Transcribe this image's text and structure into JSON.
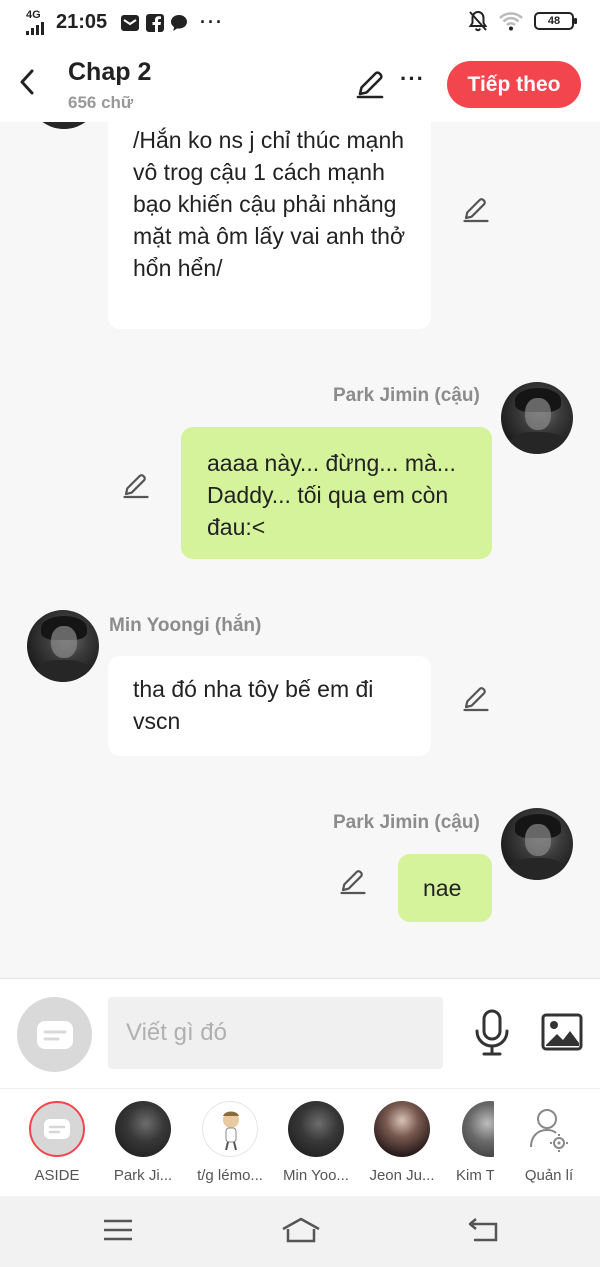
{
  "status_bar": {
    "network": "4G",
    "time": "21:05",
    "battery": "48",
    "notification_icons": [
      "mail-icon",
      "facebook-icon",
      "chat-bubble-icon",
      "more-dots-icon"
    ],
    "right_icons": [
      "mute-bell-icon",
      "wifi-icon",
      "battery-icon"
    ]
  },
  "header": {
    "title": "Chap 2",
    "subtitle": "656 chữ",
    "next_label": "Tiếp theo",
    "more_label": "···",
    "accent_color": "#f3454d"
  },
  "messages": [
    {
      "side": "left",
      "speaker": "",
      "text": "/Hắn ko ns j chỉ thúc mạnh vô trog cậu 1 cách mạnh bạo khiến cậu phải nhăng mặt mà ôm lấy vai anh thở hổn hển/"
    },
    {
      "side": "right",
      "speaker": "Park Jimin (cậu)",
      "text": "aaaa này... đừng... mà... Daddy... tối qua em còn đau:<"
    },
    {
      "side": "left",
      "speaker": "Min Yoongi (hắn)",
      "text": "tha đó nha tôy bế em đi vscn"
    },
    {
      "side": "right",
      "speaker": "Park Jimin (cậu)",
      "text": "nae"
    }
  ],
  "input": {
    "placeholder": "Viết gì đó",
    "value": ""
  },
  "characters": [
    {
      "label": "ASIDE"
    },
    {
      "label": "Park Ji..."
    },
    {
      "label": "t/g lémo..."
    },
    {
      "label": "Min Yoo..."
    },
    {
      "label": "Jeon Ju..."
    },
    {
      "label": "Kim T"
    },
    {
      "label": "Quản lí"
    }
  ],
  "colors": {
    "left_bubble": "#ffffff",
    "right_bubble": "#d4f39a",
    "background": "#f7f7f7"
  }
}
